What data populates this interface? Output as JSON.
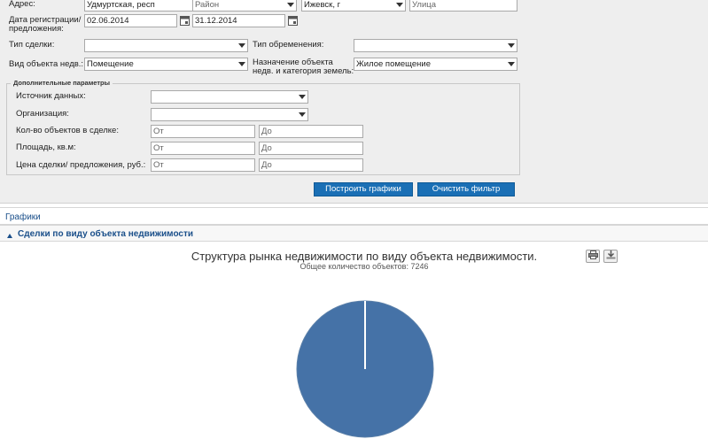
{
  "filters": {
    "address": {
      "label": "Адрес:",
      "region": "Удмуртская, респ",
      "district_placeholder": "Район",
      "city": "Ижевск, г",
      "street_placeholder": "Улица"
    },
    "date": {
      "label_line1": "Дата регистрации/",
      "label_line2": "предложения:",
      "from": "02.06.2014",
      "to": "31.12.2014"
    },
    "deal_type": {
      "label": "Тип сделки:",
      "value": ""
    },
    "encumbrance_type": {
      "label": "Тип обременения:",
      "value": ""
    },
    "object_type": {
      "label": "Вид объекта недв.:",
      "value": "Помещение"
    },
    "purpose": {
      "label_line1": "Назначение объекта",
      "label_line2": "недв. и категория земель:",
      "value": "Жилое помещение"
    }
  },
  "extra": {
    "legend": "Дополнительные параметры",
    "source": {
      "label": "Источник данных:",
      "value": ""
    },
    "organization": {
      "label": "Организация:",
      "value": ""
    },
    "object_count": {
      "label": "Кол-во объектов в сделке:",
      "from_ph": "От",
      "to_ph": "До"
    },
    "area": {
      "label": "Площадь, кв.м:",
      "from_ph": "От",
      "to_ph": "До"
    },
    "price": {
      "label": "Цена сделки/ предложения, руб.:",
      "from_ph": "От",
      "to_ph": "До"
    }
  },
  "buttons": {
    "build": "Построить графики",
    "clear": "Очистить фильтр"
  },
  "panel": {
    "title": "Графики",
    "section": "Сделки по виду объекта недвижимости"
  },
  "icons": {
    "dropdown": "chevron-down-icon",
    "calendar": "calendar-icon",
    "collapse": "triangle-up-icon",
    "print": "print-icon",
    "export": "download-icon"
  },
  "colors": {
    "button_bg": "#1a6fb5",
    "pie_main": "#4572a7",
    "link_text": "#1a4f8a"
  },
  "chart_data": {
    "type": "pie",
    "title": "Структура рынка недвижимости по виду объекта недвижимости.",
    "subtitle": "Общее количество объектов: 7246",
    "series": [
      {
        "slices": [
          {
            "value": 7246,
            "color": "#4572a7"
          }
        ]
      }
    ]
  }
}
